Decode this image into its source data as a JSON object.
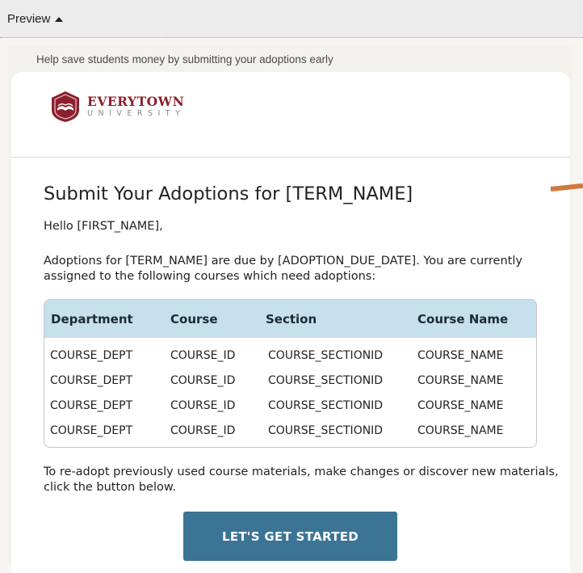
{
  "preview": {
    "label": "Preview"
  },
  "email": {
    "preheader": "Help save students money by submitting your adoptions early",
    "logo": {
      "name": "EVERYTOWN",
      "sub": "UNIVERSITY"
    },
    "title": "Submit Your Adoptions for [TERM_NAME]",
    "greeting": "Hello [FIRST_NAME],",
    "intro": "Adoptions for [TERM_NAME] are due by [ADOPTION_DUE_DATE]. You are currently assigned to the following courses which need adoptions:",
    "table": {
      "headers": [
        "Department",
        "Course",
        "Section",
        "Course Name"
      ],
      "rows": [
        [
          "COURSE_DEPT",
          "COURSE_ID",
          "COURSE_SECTIONID",
          "COURSE_NAME"
        ],
        [
          "COURSE_DEPT",
          "COURSE_ID",
          "COURSE_SECTIONID",
          "COURSE_NAME"
        ],
        [
          "COURSE_DEPT",
          "COURSE_ID",
          "COURSE_SECTIONID",
          "COURSE_NAME"
        ],
        [
          "COURSE_DEPT",
          "COURSE_ID",
          "COURSE_SECTIONID",
          "COURSE_NAME"
        ]
      ]
    },
    "outro": "To re-adopt previously used course materials, make changes or discover new materials, click the button below.",
    "cta_label": "LET'S GET STARTED"
  },
  "colors": {
    "brand": "#8c1f2c",
    "button": "#3b7495",
    "table_header": "#c6e0ee",
    "accent": "#d2773d"
  },
  "icons": {
    "preview_toggle": "caret-up-icon",
    "logo": "university-shield-book-icon"
  }
}
